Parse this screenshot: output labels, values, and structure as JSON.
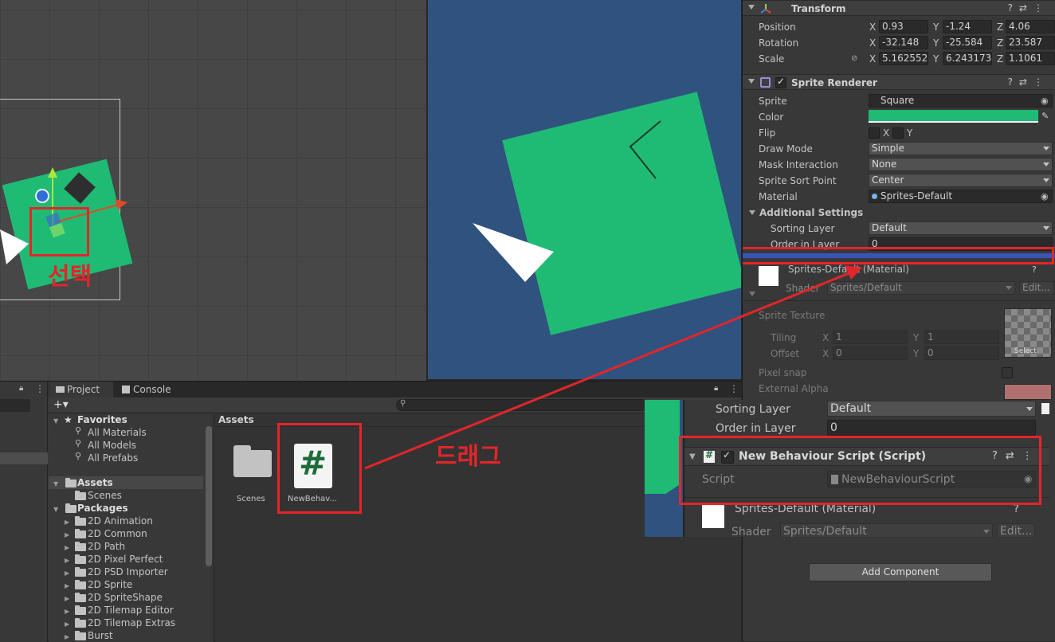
{
  "scene": {
    "annotation_select": "선택"
  },
  "annotation_drag": "드래그",
  "inspector": {
    "transform": {
      "title": "Transform",
      "position_label": "Position",
      "rotation_label": "Rotation",
      "scale_label": "Scale",
      "axis_x": "X",
      "axis_y": "Y",
      "axis_z": "Z",
      "position": {
        "x": "0.93",
        "y": "-1.24",
        "z": "4.06"
      },
      "rotation": {
        "x": "-32.148",
        "y": "-25.584",
        "z": "23.587"
      },
      "scale": {
        "x": "5.162552",
        "y": "6.243173",
        "z": "1.1061"
      }
    },
    "sprite_renderer": {
      "title": "Sprite Renderer",
      "sprite_label": "Sprite",
      "sprite_value": "Square",
      "color_label": "Color",
      "color_value": "#1fbb74",
      "flip_label": "Flip",
      "flip_x": "X",
      "flip_y": "Y",
      "draw_mode_label": "Draw Mode",
      "draw_mode_value": "Simple",
      "mask_label": "Mask Interaction",
      "mask_value": "None",
      "sort_point_label": "Sprite Sort Point",
      "sort_point_value": "Center",
      "material_label": "Material",
      "material_value": "Sprites-Default",
      "additional_settings": "Additional Settings",
      "sorting_layer_label": "Sorting Layer",
      "sorting_layer_value": "Default",
      "order_label": "Order in Layer",
      "order_value": "0"
    },
    "material": {
      "title": "Sprites-Default (Material)",
      "shader_label": "Shader",
      "shader_value": "Sprites/Default",
      "edit_label": "Edit...",
      "sprite_texture_label": "Sprite Texture",
      "tiling_label": "Tiling",
      "offset_label": "Offset",
      "tiling": {
        "x": "1",
        "y": "1"
      },
      "offset": {
        "x": "0",
        "y": "0"
      },
      "select_label": "Select",
      "pixel_snap_label": "Pixel snap",
      "external_alpha_label": "External Alpha"
    },
    "add_component_label": "Add Component"
  },
  "zoom_inset": {
    "sorting_layer_label": "Sorting Layer",
    "sorting_layer_value": "Default",
    "order_label": "Order in Layer",
    "order_value": "0",
    "script_component_title": "New Behaviour Script (Script)",
    "script_label": "Script",
    "script_value": "NewBehaviourScript",
    "material_title": "Sprites-Default (Material)",
    "shader_label": "Shader",
    "shader_value": "Sprites/Default",
    "edit_label": "Edit..."
  },
  "project": {
    "tab_project": "Project",
    "tab_console": "Console",
    "add_button": "+▾",
    "favorites": "Favorites",
    "fav_items": [
      "All Materials",
      "All Models",
      "All Prefabs"
    ],
    "assets": "Assets",
    "asset_children": [
      "Scenes"
    ],
    "packages": "Packages",
    "package_items": [
      "2D Animation",
      "2D Common",
      "2D Path",
      "2D Pixel Perfect",
      "2D PSD Importer",
      "2D Sprite",
      "2D SpriteShape",
      "2D Tilemap Editor",
      "2D Tilemap Extras",
      "Burst"
    ],
    "breadcrumb": "Assets",
    "grid_items": [
      {
        "name": "Scenes",
        "icon": "folder-icon"
      },
      {
        "name": "NewBehav...",
        "icon": "csharp-script-icon"
      }
    ]
  },
  "colors": {
    "sprite_green": "#1fbb74",
    "game_bg": "#30527e",
    "annotation_red": "#e4252a"
  }
}
